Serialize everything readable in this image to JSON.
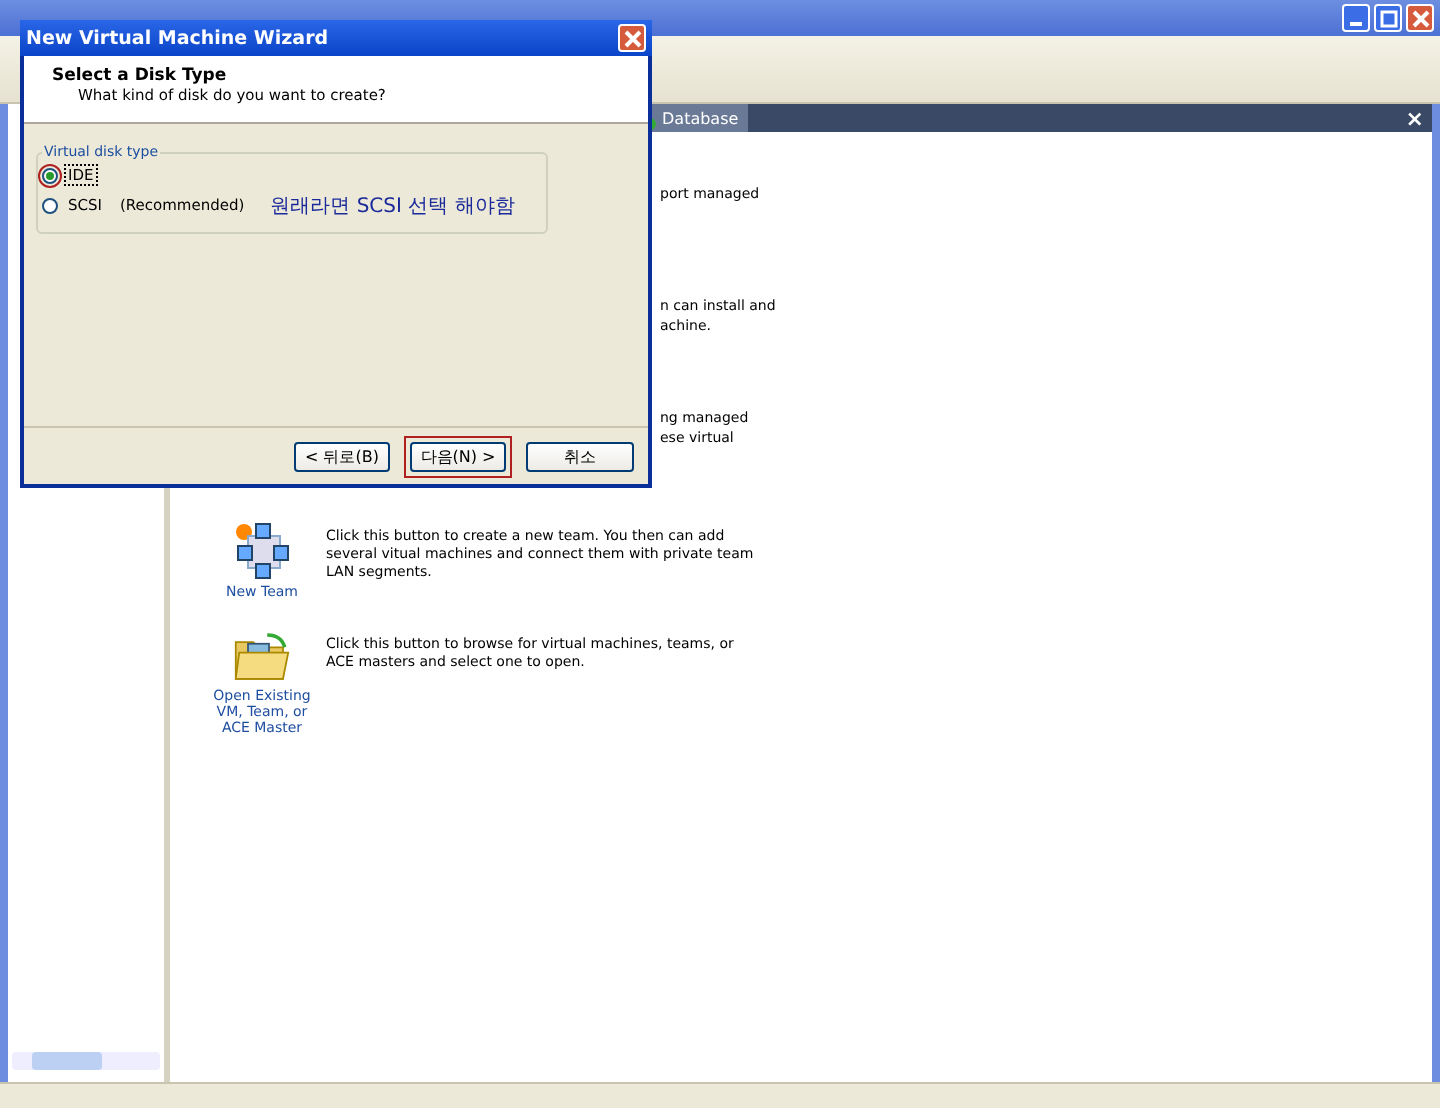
{
  "main_window": {
    "tab": {
      "label": "Database",
      "selected": true
    },
    "close_glyph": "×"
  },
  "partial_rows": [
    {
      "lines": [
        "port managed"
      ]
    },
    {
      "lines": [
        "n can install and",
        "achine."
      ]
    },
    {
      "lines": [
        "ng managed",
        "ese virtual"
      ]
    }
  ],
  "actions": [
    {
      "kind": "team",
      "label_lines": [
        "New Team"
      ],
      "description": "Click this button to create a new team. You then can add several vitual machines and connect them with private team LAN segments."
    },
    {
      "kind": "folder",
      "label_lines": [
        "Open Existing",
        "VM, Team, or",
        "ACE Master"
      ],
      "description": "Click this button to browse for virtual machines, teams, or ACE masters and select one to open."
    }
  ],
  "dialog": {
    "title": "New Virtual Machine Wizard",
    "heading": "Select a Disk Type",
    "subheading": "What kind of disk do you want to create?",
    "group_label": "Virtual disk type",
    "options": [
      {
        "label": "IDE",
        "selected": true,
        "highlighted": true
      },
      {
        "label": "SCSI",
        "note": "(Recommended)",
        "selected": false,
        "highlighted": false
      }
    ],
    "annotation": "원래라면 SCSI 선택 해야함",
    "buttons": [
      {
        "label": "< 뒤로(B)",
        "highlighted": false
      },
      {
        "label": "다음(N) >",
        "highlighted": true
      },
      {
        "label": "취소",
        "highlighted": false
      }
    ]
  }
}
